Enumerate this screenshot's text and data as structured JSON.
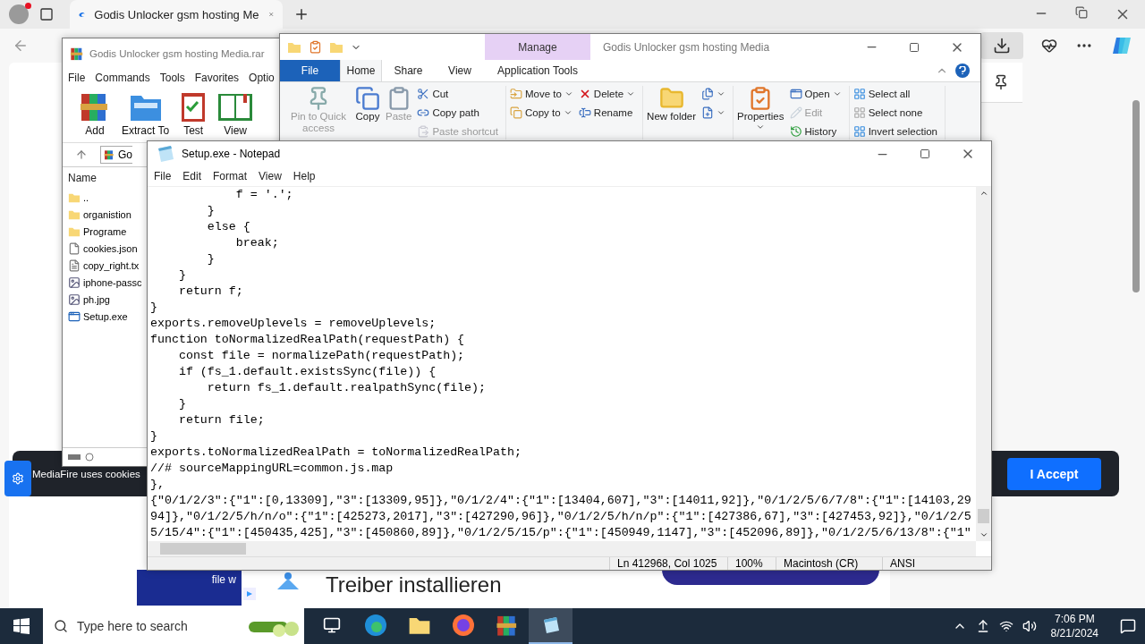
{
  "browser": {
    "tab": {
      "title": "Godis Unlocker gsm hosting Me"
    },
    "cookie_banner": {
      "text": "MediaFire uses cookies",
      "button": "I Accept"
    },
    "ad": {
      "caption": "file w",
      "headline": "Treiber installieren"
    }
  },
  "winrar": {
    "title": "Godis Unlocker gsm hosting Media.rar",
    "menu": [
      "File",
      "Commands",
      "Tools",
      "Favorites",
      "Optio"
    ],
    "toolbar": [
      {
        "label": "Add"
      },
      {
        "label": "Extract To"
      },
      {
        "label": "Test"
      },
      {
        "label": "View"
      }
    ],
    "path": "Go",
    "column": "Name",
    "files": [
      {
        "name": "..",
        "kind": "up"
      },
      {
        "name": "organistion",
        "kind": "folder"
      },
      {
        "name": "Programe",
        "kind": "folder"
      },
      {
        "name": "cookies.json",
        "kind": "file"
      },
      {
        "name": "copy_right.tx",
        "kind": "text"
      },
      {
        "name": "iphone-passc",
        "kind": "image"
      },
      {
        "name": "ph.jpg",
        "kind": "image"
      },
      {
        "name": "Setup.exe",
        "kind": "exe"
      }
    ]
  },
  "explorer": {
    "title": "Godis Unlocker gsm hosting Media",
    "context_tab": "Manage",
    "tabs": [
      {
        "label": "File",
        "kind": "file",
        "selected": false
      },
      {
        "label": "Home",
        "kind": "tab",
        "selected": true
      },
      {
        "label": "Share",
        "kind": "tab",
        "selected": false
      },
      {
        "label": "View",
        "kind": "tab",
        "selected": false
      },
      {
        "label": "Application Tools",
        "kind": "context",
        "selected": false
      }
    ],
    "ribbon": [
      {
        "columns": [
          [
            {
              "label": "Pin to Quick access",
              "kind": "large",
              "disabled": true,
              "dropdown": false
            }
          ],
          [
            {
              "label": "Copy",
              "kind": "large",
              "disabled": false,
              "dropdown": false
            }
          ],
          [
            {
              "label": "Paste",
              "kind": "large",
              "disabled": true,
              "dropdown": false
            }
          ],
          [
            {
              "label": "Cut",
              "kind": "small",
              "disabled": false,
              "dropdown": false
            },
            {
              "label": "Copy path",
              "kind": "small",
              "disabled": false,
              "dropdown": false
            },
            {
              "label": "Paste shortcut",
              "kind": "small",
              "disabled": true,
              "dropdown": false
            }
          ]
        ]
      },
      {
        "columns": [
          [
            {
              "label": "Move to",
              "kind": "small",
              "disabled": false,
              "dropdown": true
            },
            {
              "label": "Copy to",
              "kind": "small",
              "disabled": false,
              "dropdown": true
            }
          ],
          [
            {
              "label": "Delete",
              "kind": "small",
              "disabled": false,
              "dropdown": true
            },
            {
              "label": "Rename",
              "kind": "small",
              "disabled": false,
              "dropdown": false
            }
          ]
        ]
      },
      {
        "columns": [
          [
            {
              "label": "New folder",
              "kind": "large",
              "disabled": false,
              "dropdown": false
            }
          ],
          [
            {
              "kind": "icon",
              "disabled": false,
              "dropdown": true
            },
            {
              "kind": "icon",
              "disabled": false,
              "dropdown": true
            }
          ]
        ]
      },
      {
        "columns": [
          [
            {
              "label": "Properties",
              "kind": "large",
              "disabled": false,
              "dropdown": true
            }
          ],
          [
            {
              "label": "Open",
              "kind": "small",
              "disabled": false,
              "dropdown": true
            },
            {
              "label": "Edit",
              "kind": "small",
              "disabled": true,
              "dropdown": false
            },
            {
              "label": "History",
              "kind": "small",
              "disabled": false,
              "dropdown": false
            }
          ]
        ]
      },
      {
        "columns": [
          [
            {
              "label": "Select all",
              "kind": "small",
              "disabled": false,
              "dropdown": false
            },
            {
              "label": "Select none",
              "kind": "small",
              "disabled": false,
              "dropdown": false
            },
            {
              "label": "Invert selection",
              "kind": "small",
              "disabled": false,
              "dropdown": false
            }
          ]
        ]
      }
    ]
  },
  "notepad": {
    "title": "Setup.exe - Notepad",
    "menu": [
      "File",
      "Edit",
      "Format",
      "View",
      "Help"
    ],
    "lines": [
      "            f = '.';",
      "        }",
      "        else {",
      "            break;",
      "        }",
      "    }",
      "    return f;",
      "}",
      "exports.removeUplevels = removeUplevels;",
      "function toNormalizedRealPath(requestPath) {",
      "    const file = normalizePath(requestPath);",
      "    if (fs_1.default.existsSync(file)) {",
      "        return fs_1.default.realpathSync(file);",
      "    }",
      "    return file;",
      "}",
      "exports.toNormalizedRealPath = toNormalizedRealPath;",
      "//# sourceMappingURL=common.js.map",
      "},",
      "{\"0/1/2/3\":{\"1\":[0,13309],\"3\":[13309,95]},\"0/1/2/4\":{\"1\":[13404,607],\"3\":[14011,92]},\"0/1/2/5/6/7/8\":{\"1\":[14103,29",
      "94]},\"0/1/2/5/h/n/o\":{\"1\":[425273,2017],\"3\":[427290,96]},\"0/1/2/5/h/n/p\":{\"1\":[427386,67],\"3\":[427453,92]},\"0/1/2/5",
      "5/15/4\":{\"1\":[450435,425],\"3\":[450860,89]},\"0/1/2/5/15/p\":{\"1\":[450949,1147],\"3\":[452096,89]},\"0/1/2/5/6/13/8\":{\"1\""
    ],
    "status": [
      "Ln 412968, Col 1025",
      "100%",
      "Macintosh (CR)",
      "ANSI"
    ]
  },
  "taskbar": {
    "search_placeholder": "Type here to search",
    "apps": [
      {
        "kind": "taskview",
        "selected": false
      },
      {
        "kind": "edge",
        "selected": false
      },
      {
        "kind": "explorer",
        "selected": false
      },
      {
        "kind": "firefox",
        "selected": false
      },
      {
        "kind": "winrar",
        "selected": false
      },
      {
        "kind": "notepad",
        "selected": true
      }
    ],
    "time": "7:06 PM",
    "date": "8/21/2024"
  }
}
